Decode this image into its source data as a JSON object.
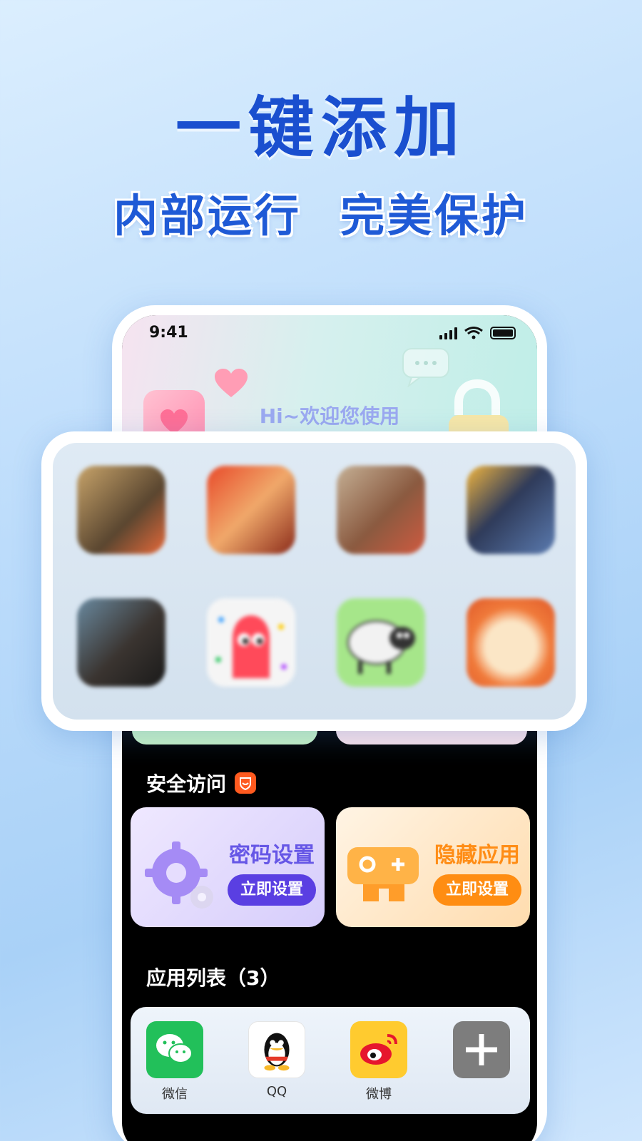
{
  "headline": "一键添加",
  "subline": {
    "part1": "内部运行",
    "part2": "完美保护"
  },
  "phone": {
    "status": {
      "time": "9:41"
    },
    "welcome": "Hi~欢迎您使用",
    "security": {
      "title": "安全访问",
      "password_card": {
        "title": "密码设置",
        "button": "立即设置"
      },
      "hide_card": {
        "title": "隐藏应用",
        "button": "立即设置"
      }
    },
    "app_list": {
      "title": "应用列表（3）",
      "apps": [
        {
          "label": "微信",
          "icon": "wechat-icon"
        },
        {
          "label": "QQ",
          "icon": "qq-icon"
        },
        {
          "label": "微博",
          "icon": "weibo-icon"
        },
        {
          "label": "",
          "icon": "add-icon"
        }
      ]
    }
  },
  "games": [
    {
      "icon": "game-1-icon",
      "color": "#8a6a3a"
    },
    {
      "icon": "game-2-icon",
      "color": "#c25a2a"
    },
    {
      "icon": "game-3-icon",
      "color": "#9a6a50"
    },
    {
      "icon": "game-4-icon",
      "color": "#3a4a6a"
    },
    {
      "icon": "game-5-icon",
      "color": "#3f3a38"
    },
    {
      "icon": "game-6-icon",
      "color": "#f2f2f2"
    },
    {
      "icon": "game-7-icon",
      "color": "#9fe07a"
    },
    {
      "icon": "game-8-icon",
      "color": "#ef8c4a"
    }
  ]
}
